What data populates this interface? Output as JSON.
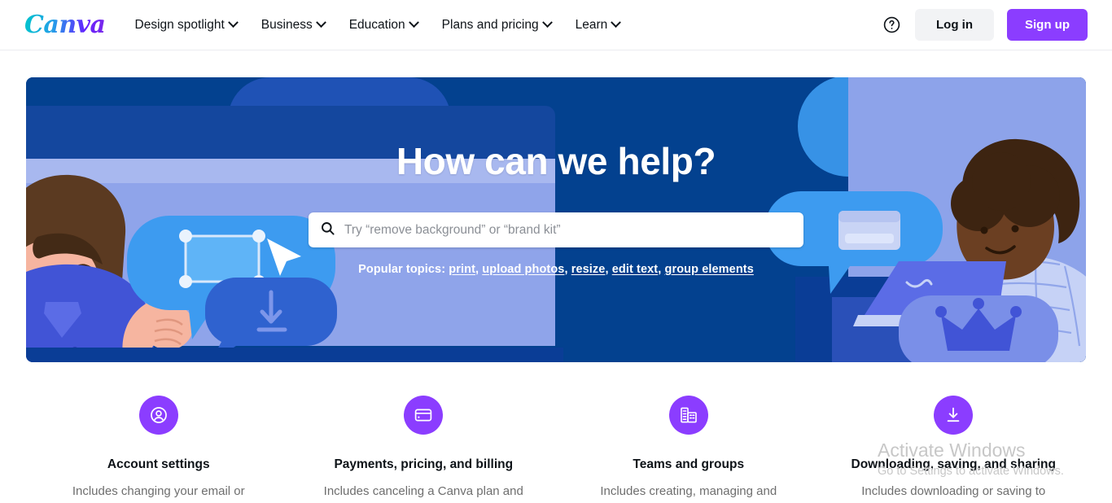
{
  "header": {
    "logo_text": "Canva",
    "nav": [
      {
        "label": "Design spotlight",
        "icon": "chevron-down-icon"
      },
      {
        "label": "Business",
        "icon": "chevron-down-icon"
      },
      {
        "label": "Education",
        "icon": "chevron-down-icon"
      },
      {
        "label": "Plans and pricing",
        "icon": "chevron-down-icon"
      },
      {
        "label": "Learn",
        "icon": "chevron-down-icon"
      }
    ],
    "help_icon": "help-circle-icon",
    "login_label": "Log in",
    "signup_label": "Sign up",
    "signup_color": "#8b3dff"
  },
  "hero": {
    "title": "How can we help?",
    "search": {
      "icon": "search-icon",
      "placeholder": "Try “remove background” or “brand kit”",
      "value": ""
    },
    "popular_label": "Popular topics:",
    "popular_links": [
      "print",
      "upload photos",
      "resize",
      "edit text",
      "group elements"
    ],
    "bg_color": "#03418f",
    "accent_blue": "#1f52b5",
    "light_panel": "#8da3ea",
    "bubble_blue": "#3d9bf0"
  },
  "categories": [
    {
      "icon": "user-circle-icon",
      "title": "Account settings",
      "desc": "Includes changing your email or"
    },
    {
      "icon": "credit-card-icon",
      "title": "Payments, pricing, and billing",
      "desc": "Includes canceling a Canva plan and"
    },
    {
      "icon": "buildings-icon",
      "title": "Teams and groups",
      "desc": "Includes creating, managing and"
    },
    {
      "icon": "download-icon",
      "title": "Downloading, saving, and sharing",
      "desc": "Includes downloading or saving to"
    }
  ],
  "watermark": {
    "title": "Activate Windows",
    "subtitle": "Go to Settings to activate Windows."
  }
}
